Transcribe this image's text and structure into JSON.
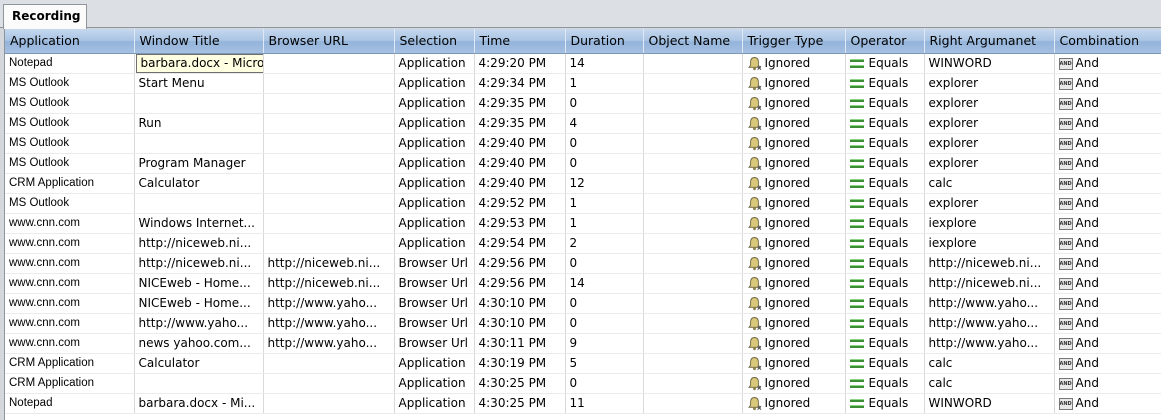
{
  "tab": {
    "label": "Recording"
  },
  "columns": [
    "Application",
    "Window Title",
    "Browser URL",
    "Selection",
    "Time",
    "Duration",
    "Object Name",
    "Trigger Type",
    "Operator",
    "Right Argumanet",
    "Combination"
  ],
  "editor": {
    "row": 0,
    "value": "barbara.docx - Microsoft Word"
  },
  "icons": {
    "trigger": "bell-icon",
    "operator": "equals-icon",
    "combination": "and-icon"
  },
  "rows": [
    [
      "Notepad",
      "barbara.docx - Microsoft Word",
      "",
      "Application",
      "4:29:20 PM",
      "14",
      "",
      "Ignored",
      "Equals",
      "WINWORD",
      "And"
    ],
    [
      "MS Outlook",
      "Start Menu",
      "",
      "Application",
      "4:29:34 PM",
      "1",
      "",
      "Ignored",
      "Equals",
      "explorer",
      "And"
    ],
    [
      "MS Outlook",
      "",
      "",
      "Application",
      "4:29:35 PM",
      "0",
      "",
      "Ignored",
      "Equals",
      "explorer",
      "And"
    ],
    [
      "MS Outlook",
      "Run",
      "",
      "Application",
      "4:29:35 PM",
      "4",
      "",
      "Ignored",
      "Equals",
      "explorer",
      "And"
    ],
    [
      "MS Outlook",
      "",
      "",
      "Application",
      "4:29:40 PM",
      "0",
      "",
      "Ignored",
      "Equals",
      "explorer",
      "And"
    ],
    [
      "MS Outlook",
      "Program Manager",
      "",
      "Application",
      "4:29:40 PM",
      "0",
      "",
      "Ignored",
      "Equals",
      "explorer",
      "And"
    ],
    [
      "CRM Application",
      "Calculator",
      "",
      "Application",
      "4:29:40 PM",
      "12",
      "",
      "Ignored",
      "Equals",
      "calc",
      "And"
    ],
    [
      "MS Outlook",
      "",
      "",
      "Application",
      "4:29:52 PM",
      "1",
      "",
      "Ignored",
      "Equals",
      "explorer",
      "And"
    ],
    [
      "www.cnn.com",
      "Windows Internet...",
      "",
      "Application",
      "4:29:53 PM",
      "1",
      "",
      "Ignored",
      "Equals",
      "iexplore",
      "And"
    ],
    [
      "www.cnn.com",
      "http://niceweb.ni...",
      "",
      "Application",
      "4:29:54 PM",
      "2",
      "",
      "Ignored",
      "Equals",
      "iexplore",
      "And"
    ],
    [
      "www.cnn.com",
      "http://niceweb.ni...",
      "http://niceweb.ni...",
      "Browser Url",
      "4:29:56 PM",
      "0",
      "",
      "Ignored",
      "Equals",
      "http://niceweb.ni...",
      "And"
    ],
    [
      "www.cnn.com",
      "NICEweb - Home...",
      "http://niceweb.ni...",
      "Browser Url",
      "4:29:56 PM",
      "14",
      "",
      "Ignored",
      "Equals",
      "http://niceweb.ni...",
      "And"
    ],
    [
      "www.cnn.com",
      "NICEweb - Home...",
      "http://www.yaho...",
      "Browser Url",
      "4:30:10 PM",
      "0",
      "",
      "Ignored",
      "Equals",
      "http://www.yaho...",
      "And"
    ],
    [
      "www.cnn.com",
      "http://www.yaho...",
      "http://www.yaho...",
      "Browser Url",
      "4:30:10 PM",
      "0",
      "",
      "Ignored",
      "Equals",
      "http://www.yaho...",
      "And"
    ],
    [
      "www.cnn.com",
      "news yahoo.com...",
      "http://www.yaho...",
      "Browser Url",
      "4:30:11 PM",
      "9",
      "",
      "Ignored",
      "Equals",
      "http://www.yaho...",
      "And"
    ],
    [
      "CRM Application",
      "Calculator",
      "",
      "Application",
      "4:30:19 PM",
      "5",
      "",
      "Ignored",
      "Equals",
      "calc",
      "And"
    ],
    [
      "CRM Application",
      "",
      "",
      "Application",
      "4:30:25 PM",
      "0",
      "",
      "Ignored",
      "Equals",
      "calc",
      "And"
    ],
    [
      "Notepad",
      "barbara.docx - Mi...",
      "",
      "Application",
      "4:30:25 PM",
      "11",
      "",
      "Ignored",
      "Equals",
      "WINWORD",
      "And"
    ]
  ]
}
